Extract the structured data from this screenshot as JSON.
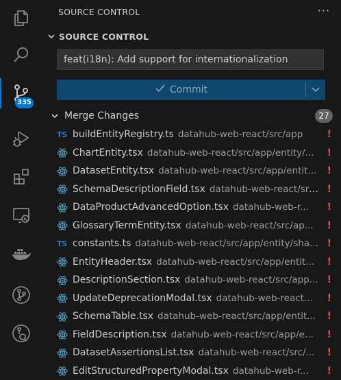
{
  "activity_bar": {
    "items": [
      "explorer",
      "search",
      "source-control",
      "run-and-debug",
      "extensions",
      "remote-explorer",
      "docker",
      "git-graph",
      "gitlens"
    ],
    "scm_badge": "335"
  },
  "sidebar": {
    "header_title": "SOURCE CONTROL",
    "more_label": "···",
    "section_title": "SOURCE CONTROL",
    "commit_message": "feat(i18n): Add support for internationalization",
    "commit_label": "Commit",
    "merge_group": {
      "title": "Merge Changes",
      "count": "27"
    },
    "files": [
      {
        "name": "buildEntityRegistry.ts",
        "path": "datahub-web-react/src/app",
        "type": "ts",
        "status": "!"
      },
      {
        "name": "ChartEntity.tsx",
        "path": "datahub-web-react/src/app/entity/...",
        "type": "tsx",
        "status": "!"
      },
      {
        "name": "DatasetEntity.tsx",
        "path": "datahub-web-react/src/app/entit...",
        "type": "tsx",
        "status": "!"
      },
      {
        "name": "SchemaDescriptionField.tsx",
        "path": "datahub-web-react/src/...",
        "type": "tsx",
        "status": "!"
      },
      {
        "name": "DataProductAdvancedOption.tsx",
        "path": "datahub-web-r...",
        "type": "tsx",
        "status": "!"
      },
      {
        "name": "GlossaryTermEntity.tsx",
        "path": "datahub-web-react/src/ap...",
        "type": "tsx",
        "status": "!"
      },
      {
        "name": "constants.ts",
        "path": "datahub-web-react/src/app/entity/sha...",
        "type": "ts",
        "status": "!"
      },
      {
        "name": "EntityHeader.tsx",
        "path": "datahub-web-react/src/app/entit...",
        "type": "tsx",
        "status": "!"
      },
      {
        "name": "DescriptionSection.tsx",
        "path": "datahub-web-react/src/app...",
        "type": "tsx",
        "status": "!"
      },
      {
        "name": "UpdateDeprecationModal.tsx",
        "path": "datahub-web-react...",
        "type": "tsx",
        "status": "!"
      },
      {
        "name": "SchemaTable.tsx",
        "path": "datahub-web-react/src/app/entit...",
        "type": "tsx",
        "status": "!"
      },
      {
        "name": "FieldDescription.tsx",
        "path": "datahub-web-react/src/app/e...",
        "type": "tsx",
        "status": "!"
      },
      {
        "name": "DatasetAssertionsList.tsx",
        "path": "datahub-web-react/src/...",
        "type": "tsx",
        "status": "!"
      },
      {
        "name": "EditStructuredPropertyModal.tsx",
        "path": "datahub-web-r...",
        "type": "tsx",
        "status": "!"
      }
    ]
  },
  "colors": {
    "accent": "#0078d4",
    "status_conflict": "#f14c4c",
    "ts_icon": "#3178c6",
    "react_icon": "#519aba"
  }
}
